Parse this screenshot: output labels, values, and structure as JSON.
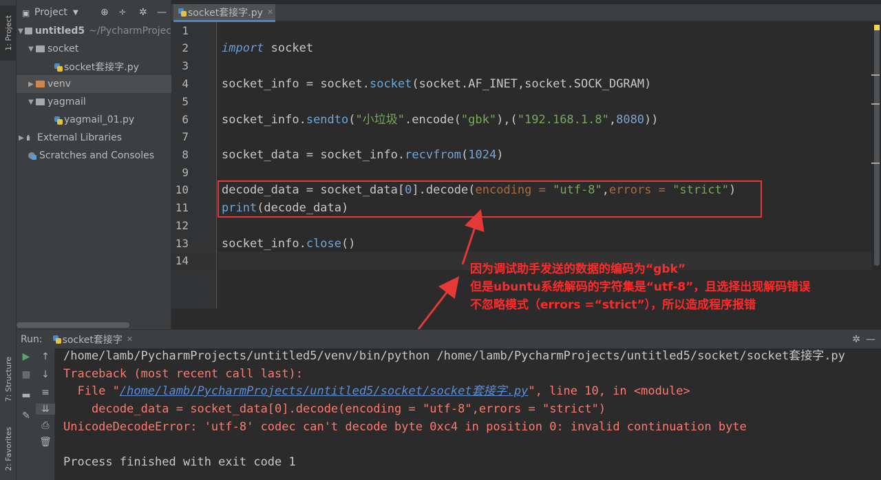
{
  "sidebar": {
    "project_tab": "1: Project",
    "structure_tab": "7: Structure",
    "favorites_tab": "2: Favorites"
  },
  "project": {
    "header": "Project",
    "tree": [
      {
        "label": "untitled5",
        "path": "~/PycharmProjec"
      },
      {
        "label": "socket"
      },
      {
        "label": "socket套接字.py"
      },
      {
        "label": "venv"
      },
      {
        "label": "yagmail"
      },
      {
        "label": "yagmail_01.py"
      },
      {
        "label": "External Libraries"
      },
      {
        "label": "Scratches and Consoles"
      }
    ]
  },
  "editor": {
    "tab_label": "socket套接字.py",
    "line_numbers": [
      "1",
      "2",
      "3",
      "4",
      "5",
      "6",
      "7",
      "8",
      "9",
      "10",
      "11",
      "12",
      "13",
      "14"
    ],
    "code": {
      "l2_kw": "import",
      "l2_rest": " socket",
      "l4_a": "socket_info ",
      "l4_eq": "=",
      "l4_b": " socket.",
      "l4_fn": "socket",
      "l4_c": "(socket.AF_INET,socket.SOCK_DGRAM)",
      "l6_a": "socket_info.",
      "l6_fn": "sendto",
      "l6_b": "(",
      "l6_s1": "\"小垃圾\"",
      "l6_c": ".encode(",
      "l6_s2": "\"gbk\"",
      "l6_d": "),(",
      "l6_s3": "\"192.168.1.8\"",
      "l6_e": ",",
      "l6_n": "8080",
      "l6_f": "))",
      "l8_a": "socket_data ",
      "l8_eq": "=",
      "l8_b": " socket_info.",
      "l8_fn": "recvfrom",
      "l8_c": "(",
      "l8_n": "1024",
      "l8_d": ")",
      "l10_a": "decode_data ",
      "l10_eq": "=",
      "l10_b": " socket_data[",
      "l10_n": "0",
      "l10_c": "].decode(",
      "l10_p1": "encoding = ",
      "l10_s1": "\"utf-8\"",
      "l10_d": ",",
      "l10_p2": "errors = ",
      "l10_s2": "\"strict\"",
      "l10_e": ")",
      "l11_fn": "print",
      "l11_rest": "(decode_data)",
      "l13_a": "socket_info.",
      "l13_fn": "close",
      "l13_b": "()"
    }
  },
  "annotation": {
    "line1": "因为调试助手发送的数据的编码为“gbk”",
    "line2": "但是ubuntu系统解码的字符集是“utf-8”，且选择出现解码错误",
    "line3": "不忽略模式（errors =“strict”），所以造成程序报错"
  },
  "run": {
    "label": "Run:",
    "tab": "socket套接字",
    "output": {
      "cmd": "/home/lamb/PycharmProjects/untitled5/venv/bin/python /home/lamb/PycharmProjects/untitled5/socket/socket套接字.py",
      "traceback": "Traceback (most recent call last):",
      "file_pre": "  File \"",
      "file_link": "/home/lamb/PycharmProjects/untitled5/socket/socket套接字.py",
      "file_post": "\", line 10, in <module>",
      "code_line": "    decode_data = socket_data[0].decode(encoding = \"utf-8\",errors = \"strict\")",
      "error": "UnicodeDecodeError: 'utf-8' codec can't decode byte 0xc4 in position 0: invalid continuation byte",
      "finished": "Process finished with exit code 1"
    }
  },
  "colors": {
    "annotation": "#ff2a2a",
    "error_output": "#ff7a6e",
    "keyword": "#6b9cd4",
    "string": "#79a85b"
  }
}
